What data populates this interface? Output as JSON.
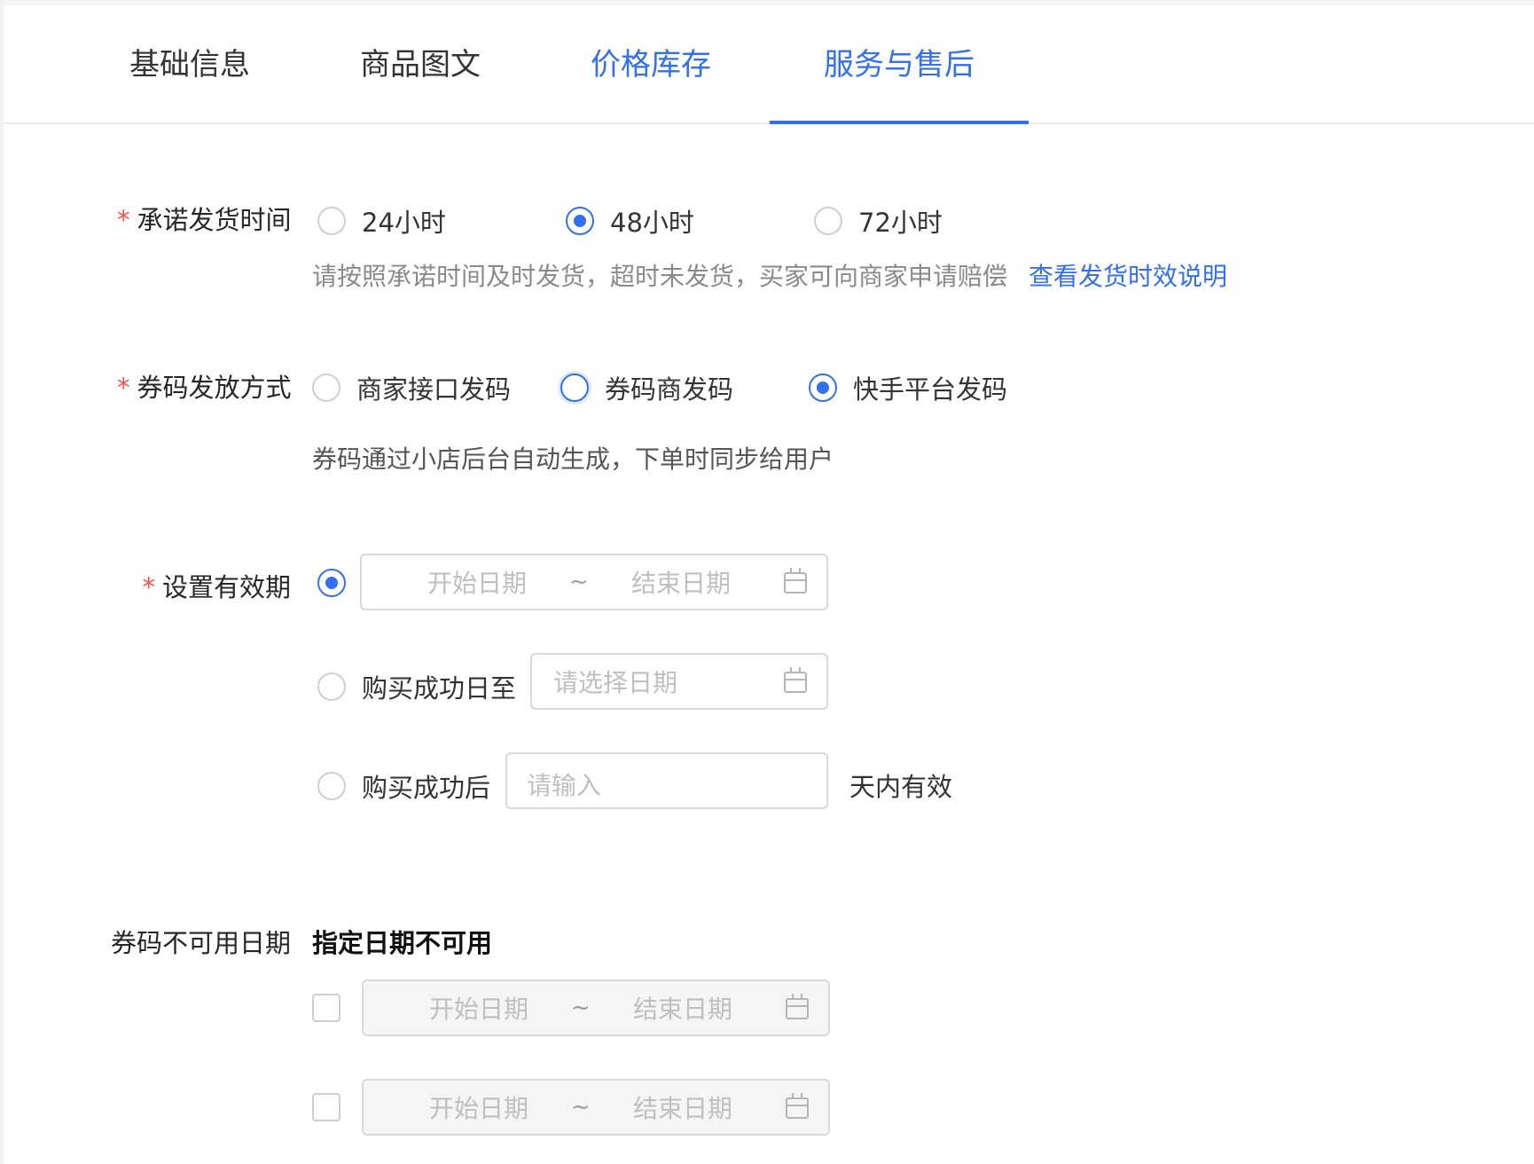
{
  "tabs": [
    {
      "label": "基础信息"
    },
    {
      "label": "商品图文"
    },
    {
      "label": "价格库存"
    },
    {
      "label": "服务与售后"
    }
  ],
  "active_tab": "服务与售后",
  "accent_color": "#3370f0",
  "required_mark": "*",
  "delivery": {
    "label": "承诺发货时间",
    "options": [
      "24小时",
      "48小时",
      "72小时"
    ],
    "selected": "48小时",
    "help": "请按照承诺时间及时发货，超时未发货，买家可向商家申请赔偿",
    "help_link": "查看发货时效说明"
  },
  "coupon_code": {
    "label": "券码发放方式",
    "options": [
      "商家接口发码",
      "券码商发码",
      "快手平台发码"
    ],
    "selected": "快手平台发码",
    "description": "券码通过小店后台自动生成，下单时同步给用户"
  },
  "validity": {
    "label": "设置有效期",
    "range_start_placeholder": "开始日期",
    "range_separator": "~",
    "range_end_placeholder": "结束日期",
    "until_label": "购买成功日至",
    "until_placeholder": "请选择日期",
    "after_label": "购买成功后",
    "after_placeholder": "请输入",
    "after_suffix": "天内有效"
  },
  "unavailable": {
    "label": "券码不可用日期",
    "sub_title": "指定日期不可用",
    "rows": [
      {
        "start_placeholder": "开始日期",
        "separator": "~",
        "end_placeholder": "结束日期"
      },
      {
        "start_placeholder": "开始日期",
        "separator": "~",
        "end_placeholder": "结束日期"
      }
    ]
  },
  "icons": [
    "calendar-icon"
  ]
}
